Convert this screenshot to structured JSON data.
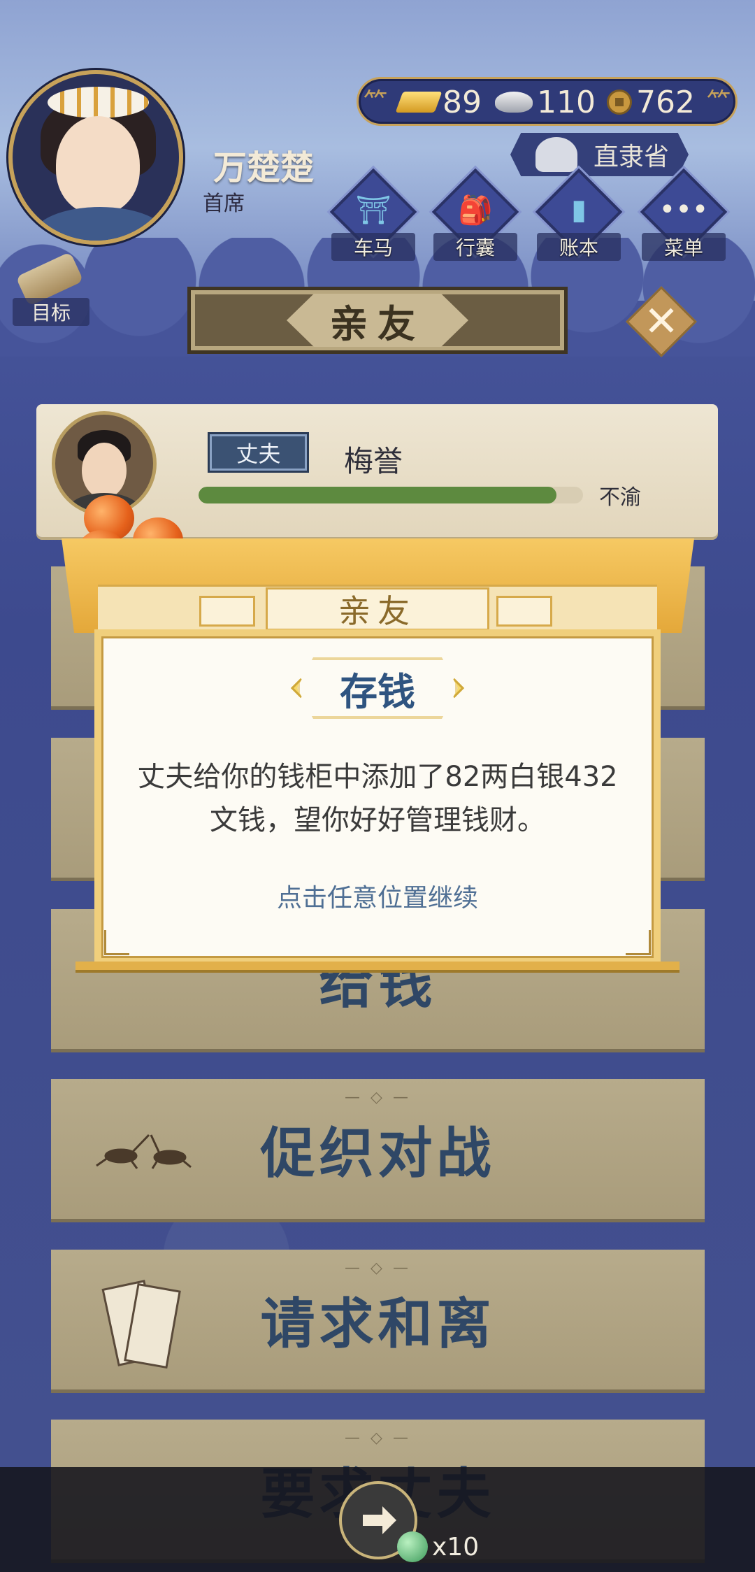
{
  "player": {
    "name": "万楚楚",
    "title": "首席"
  },
  "currency": {
    "gold": "89",
    "silver": "110",
    "coins": "762"
  },
  "location": "直隶省",
  "nav": [
    {
      "label": "车马",
      "icon": "carriage-icon"
    },
    {
      "label": "行囊",
      "icon": "bag-icon"
    },
    {
      "label": "账本",
      "icon": "ledger-icon"
    },
    {
      "label": "菜单",
      "icon": "menu-icon"
    }
  ],
  "goal_label": "目标",
  "page_title": "亲友",
  "relative": {
    "tag": "丈夫",
    "name": "梅誉",
    "status": "不渝",
    "affection": 0.93
  },
  "actions": [
    {
      "label": "给钱",
      "icon": "hand-coin-icon"
    },
    {
      "label": "促织对战",
      "icon": "cricket-icon"
    },
    {
      "label": "请求和离",
      "icon": "divorce-letter-icon"
    },
    {
      "label": "要求丈夫",
      "icon": "hand-icon"
    }
  ],
  "modal": {
    "tab": "亲友",
    "heading": "存钱",
    "message": "丈夫给你的钱柜中添加了82两白银432文钱，望你好好管理钱财。",
    "hint": "点击任意位置继续"
  },
  "share": {
    "count": "x10"
  }
}
